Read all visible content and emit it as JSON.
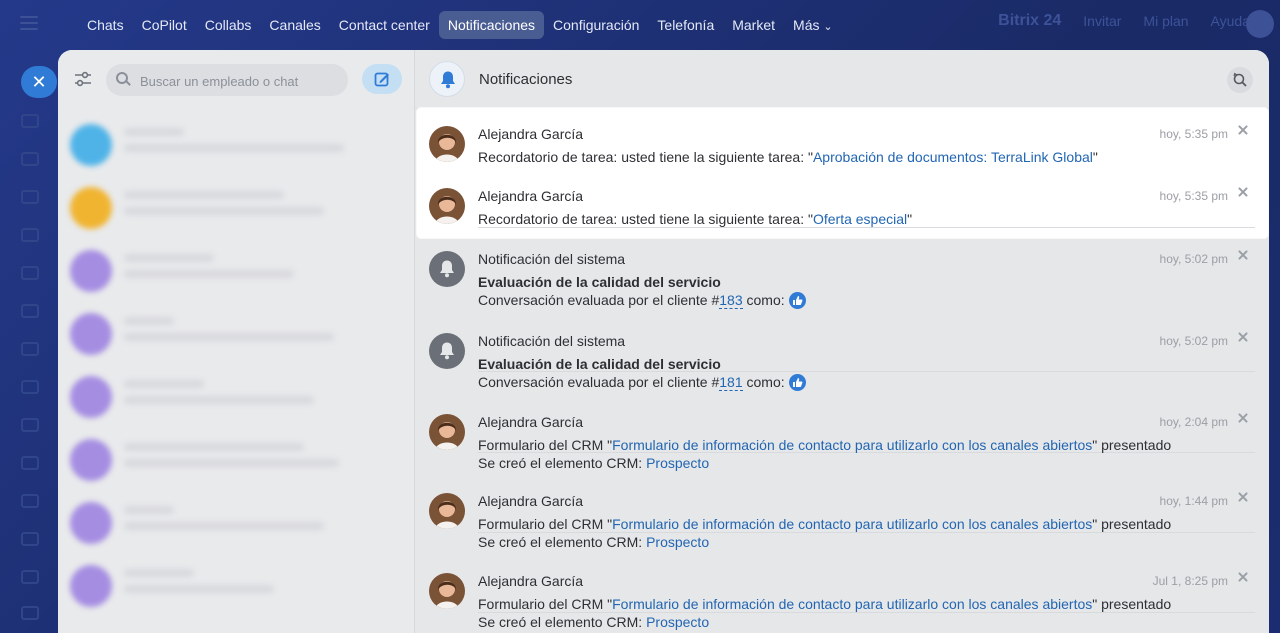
{
  "topnav": {
    "items": [
      {
        "label": "Chats"
      },
      {
        "label": "CoPilot"
      },
      {
        "label": "Collabs"
      },
      {
        "label": "Canales"
      },
      {
        "label": "Contact center"
      },
      {
        "label": "Notificaciones"
      },
      {
        "label": "Configuración"
      },
      {
        "label": "Telefonía"
      },
      {
        "label": "Market"
      },
      {
        "label": "Más"
      }
    ],
    "more_chevron": "⌄",
    "brand": "Bitrix 24",
    "right_links": [
      "Invitar",
      "Mi plan",
      "Ayuda"
    ]
  },
  "sidebar": {
    "close_glyph": "✕",
    "search_placeholder": "Buscar un empleado o chat"
  },
  "notifications": {
    "title": "Notificaciones",
    "items": [
      {
        "author": "Alejandra García",
        "time": "hoy, 5:35 pm",
        "text_prefix": "Recordatorio de tarea: usted tiene la siguiente tarea: \"",
        "link": "Aprobación de documentos: TerraLink Global",
        "text_suffix": "\""
      },
      {
        "author": "Alejandra García",
        "time": "hoy, 5:35 pm",
        "text_prefix": "Recordatorio de tarea: usted tiene la siguiente tarea: \"",
        "link": "Oferta especial",
        "text_suffix": "\""
      },
      {
        "author": "Notificación del sistema",
        "time": "hoy, 5:02 pm",
        "heading": "Evaluación de la calidad del servicio",
        "text_prefix": "Conversación evaluada por el cliente #",
        "link": "183",
        "text_suffix": " como:"
      },
      {
        "author": "Notificación del sistema",
        "time": "hoy, 5:02 pm",
        "heading": "Evaluación de la calidad del servicio",
        "text_prefix": "Conversación evaluada por el cliente #",
        "link": "181",
        "text_suffix": " como:"
      },
      {
        "author": "Alejandra García",
        "time": "hoy, 2:04 pm",
        "text_prefix": "Formulario del CRM \"",
        "link": "Formulario de información de contacto para utilizarlo con los canales abiertos",
        "text_suffix": "\" presentado",
        "line2_prefix": "Se creó el elemento CRM: ",
        "line2_link": "Prospecto"
      },
      {
        "author": "Alejandra García",
        "time": "hoy, 1:44 pm",
        "text_prefix": "Formulario del CRM \"",
        "link": "Formulario de información de contacto para utilizarlo con los canales abiertos",
        "text_suffix": "\" presentado",
        "line2_prefix": "Se creó el elemento CRM: ",
        "line2_link": "Prospecto"
      },
      {
        "author": "Alejandra García",
        "time": "Jul 1, 8:25 pm",
        "text_prefix": "Formulario del CRM \"",
        "link": "Formulario de información de contacto para utilizarlo con los canales abiertos",
        "text_suffix": "\" presentado",
        "line2_prefix": "Se creó el elemento CRM: ",
        "line2_link": "Prospecto"
      }
    ]
  },
  "colors": {
    "accent": "#2f7bd6",
    "link": "#2266b3",
    "nav_bg": "#1d2f6e"
  }
}
